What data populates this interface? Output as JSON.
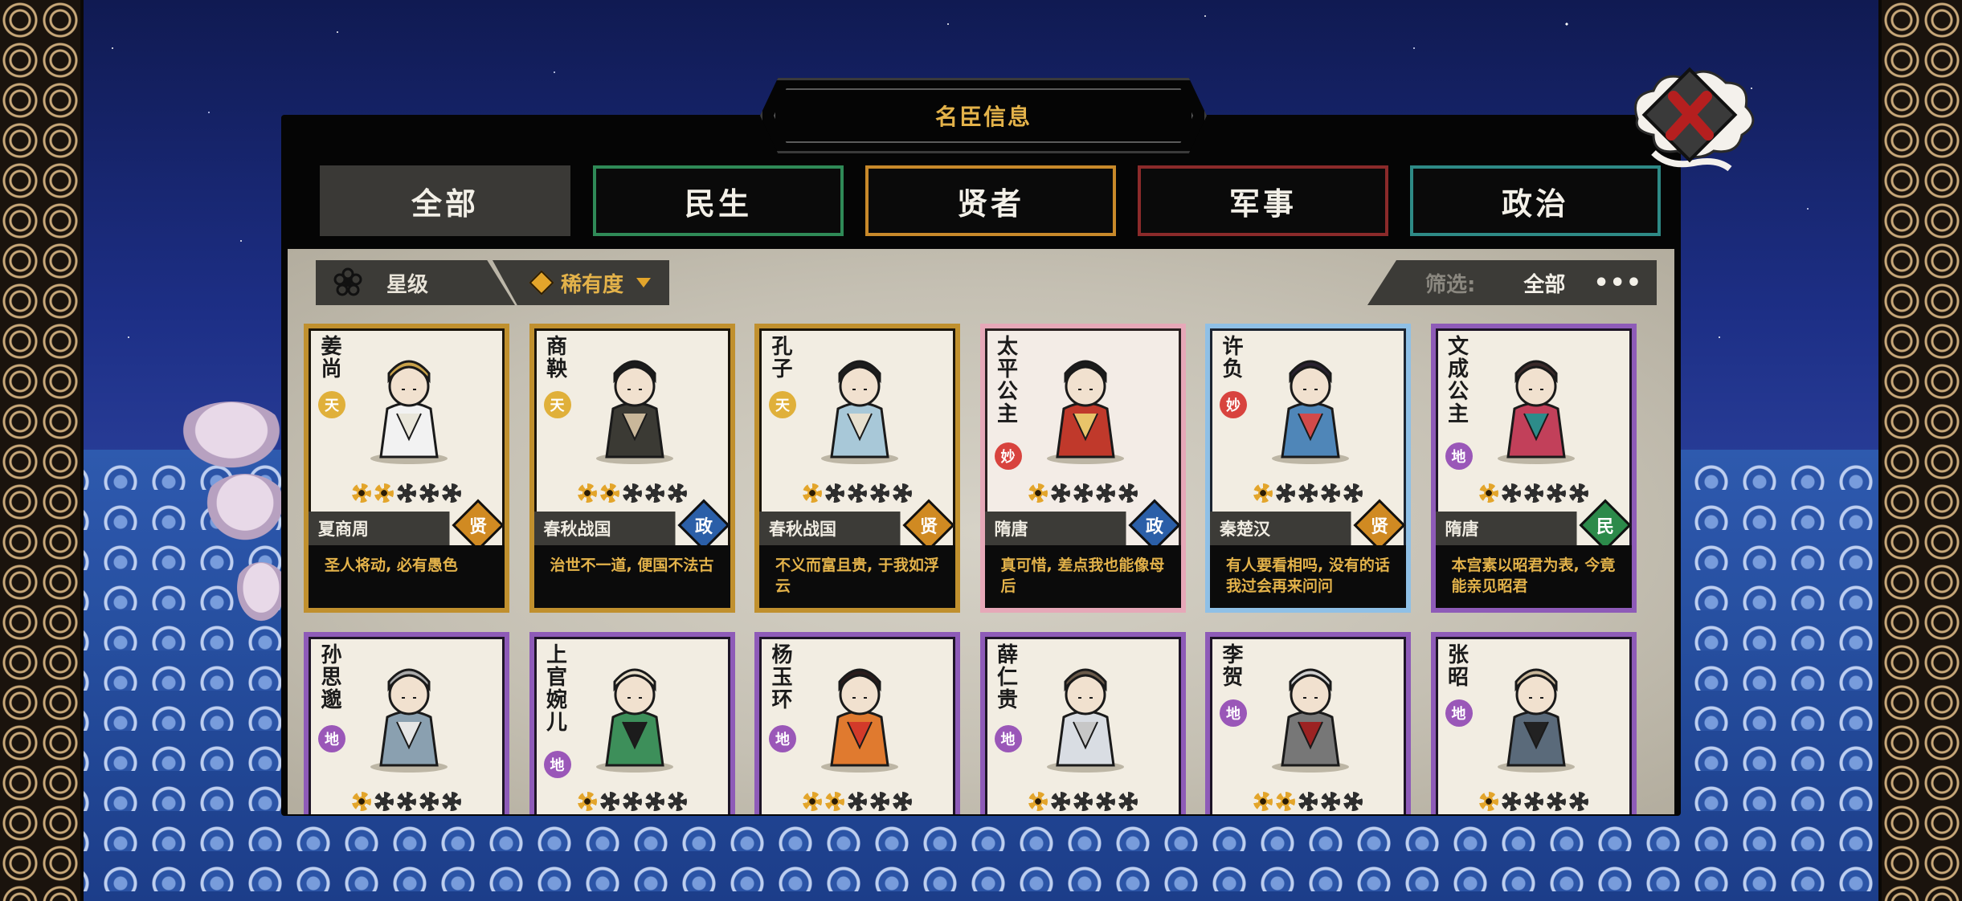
{
  "title": "名臣信息",
  "tabs": [
    {
      "label": "全部",
      "color": "#3a3936",
      "active": true
    },
    {
      "label": "民生",
      "color": "#2f8a57",
      "active": false
    },
    {
      "label": "贤者",
      "color": "#c8892a",
      "active": false
    },
    {
      "label": "军事",
      "color": "#8b2a2a",
      "active": false
    },
    {
      "label": "政治",
      "color": "#2e8a86",
      "active": false
    }
  ],
  "sort": {
    "star_label": "星级",
    "rarity_label": "稀有度"
  },
  "filter": {
    "label": "筛选:",
    "value": "全部"
  },
  "rarity_colors": {
    "天": "#e0b03a",
    "妙": "#d8433e",
    "地": "#9a57b8"
  },
  "type_colors": {
    "贤": "#d08a22",
    "政": "#2b5fa8",
    "民": "#2c8a4a"
  },
  "ministers": [
    {
      "name": "姜尚",
      "rarity": "天",
      "stars": 2,
      "era": "夏商周",
      "type": "贤",
      "quote": "圣人将动, 必有愚色",
      "frame": "gold"
    },
    {
      "name": "商鞅",
      "rarity": "天",
      "stars": 2,
      "era": "春秋战国",
      "type": "政",
      "quote": "治世不一道, 便国不法古",
      "frame": "gold"
    },
    {
      "name": "孔子",
      "rarity": "天",
      "stars": 1,
      "era": "春秋战国",
      "type": "贤",
      "quote": "不义而富且贵, 于我如浮云",
      "frame": "gold"
    },
    {
      "name": "太平公主",
      "rarity": "妙",
      "stars": 1,
      "era": "隋唐",
      "type": "政",
      "quote": "真可惜, 差点我也能像母后",
      "frame": "pink"
    },
    {
      "name": "许负",
      "rarity": "妙",
      "stars": 1,
      "era": "秦楚汉",
      "type": "贤",
      "quote": "有人要看相吗, 没有的话我过会再来问问",
      "frame": "blue"
    },
    {
      "name": "文成公主",
      "rarity": "地",
      "stars": 1,
      "era": "隋唐",
      "type": "民",
      "quote": "本宫素以昭君为表, 今竟能亲见昭君",
      "frame": "purple"
    },
    {
      "name": "孙思邈",
      "rarity": "地",
      "stars": 1,
      "era": "",
      "type": "",
      "quote": "",
      "frame": "purple"
    },
    {
      "name": "上官婉儿",
      "rarity": "地",
      "stars": 1,
      "era": "",
      "type": "",
      "quote": "",
      "frame": "purple"
    },
    {
      "name": "杨玉环",
      "rarity": "地",
      "stars": 2,
      "era": "",
      "type": "",
      "quote": "",
      "frame": "purple"
    },
    {
      "name": "薛仁贵",
      "rarity": "地",
      "stars": 1,
      "era": "",
      "type": "",
      "quote": "",
      "frame": "purple"
    },
    {
      "name": "李贺",
      "rarity": "地",
      "stars": 2,
      "era": "",
      "type": "",
      "quote": "",
      "frame": "purple"
    },
    {
      "name": "张昭",
      "rarity": "地",
      "stars": 1,
      "era": "",
      "type": "",
      "quote": "",
      "frame": "purple"
    }
  ]
}
